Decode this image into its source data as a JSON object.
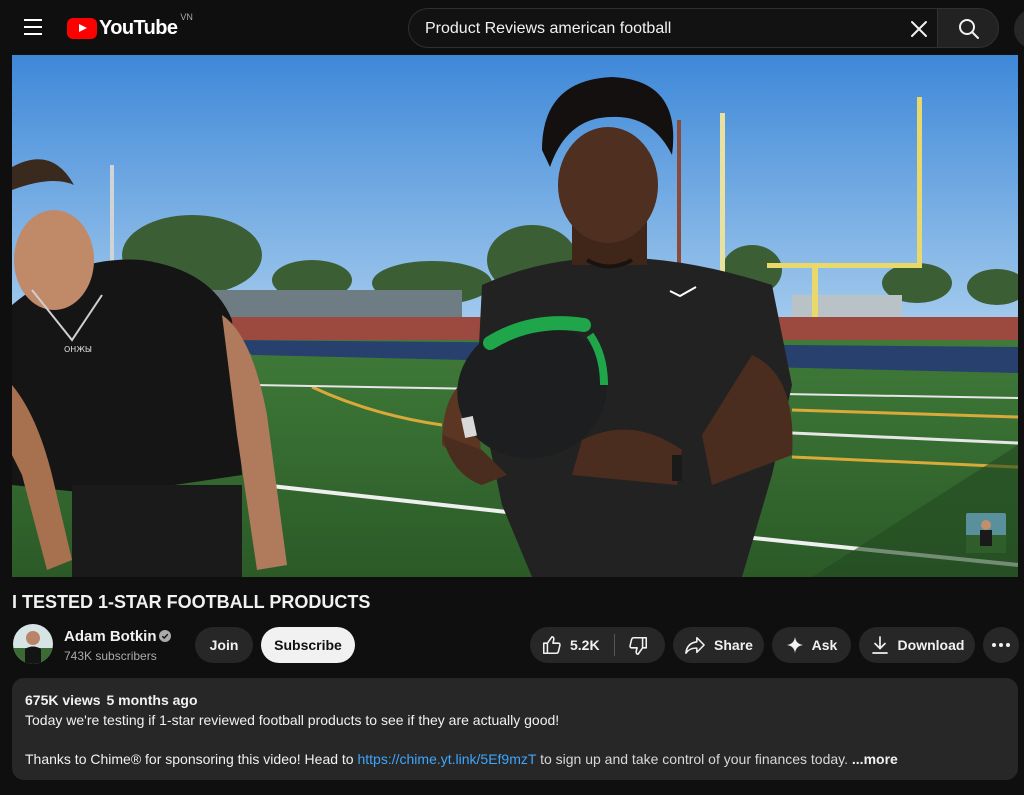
{
  "header": {
    "logo_text": "YouTube",
    "region": "VN",
    "search_query": "Product Reviews american football"
  },
  "video": {
    "title": "I TESTED 1-STAR FOOTBALL PRODUCTS",
    "shirt_text_left": "ОНЖЫ"
  },
  "channel": {
    "name": "Adam Botkin",
    "subscribers": "743K subscribers",
    "join_label": "Join",
    "subscribe_label": "Subscribe"
  },
  "actions": {
    "likes": "5.2K",
    "share_label": "Share",
    "ask_label": "Ask",
    "download_label": "Download"
  },
  "description": {
    "views": "675K views",
    "age": "5 months ago",
    "line1": "Today we're testing if 1-star reviewed football products to see if they are actually good!",
    "line2_prefix": "Thanks to Chime® for sponsoring this video! Head to ",
    "line2_link": "https://chime.yt.link/5Ef9mzT",
    "line2_suffix": " to sign up and take control of your finances today.",
    "more_label": "...more"
  },
  "colors": {
    "brand_red": "#ff0000",
    "background": "#0f0f0f",
    "surface": "#272727",
    "link": "#3ea6ff",
    "ball_stripe": "#1fa64a"
  }
}
